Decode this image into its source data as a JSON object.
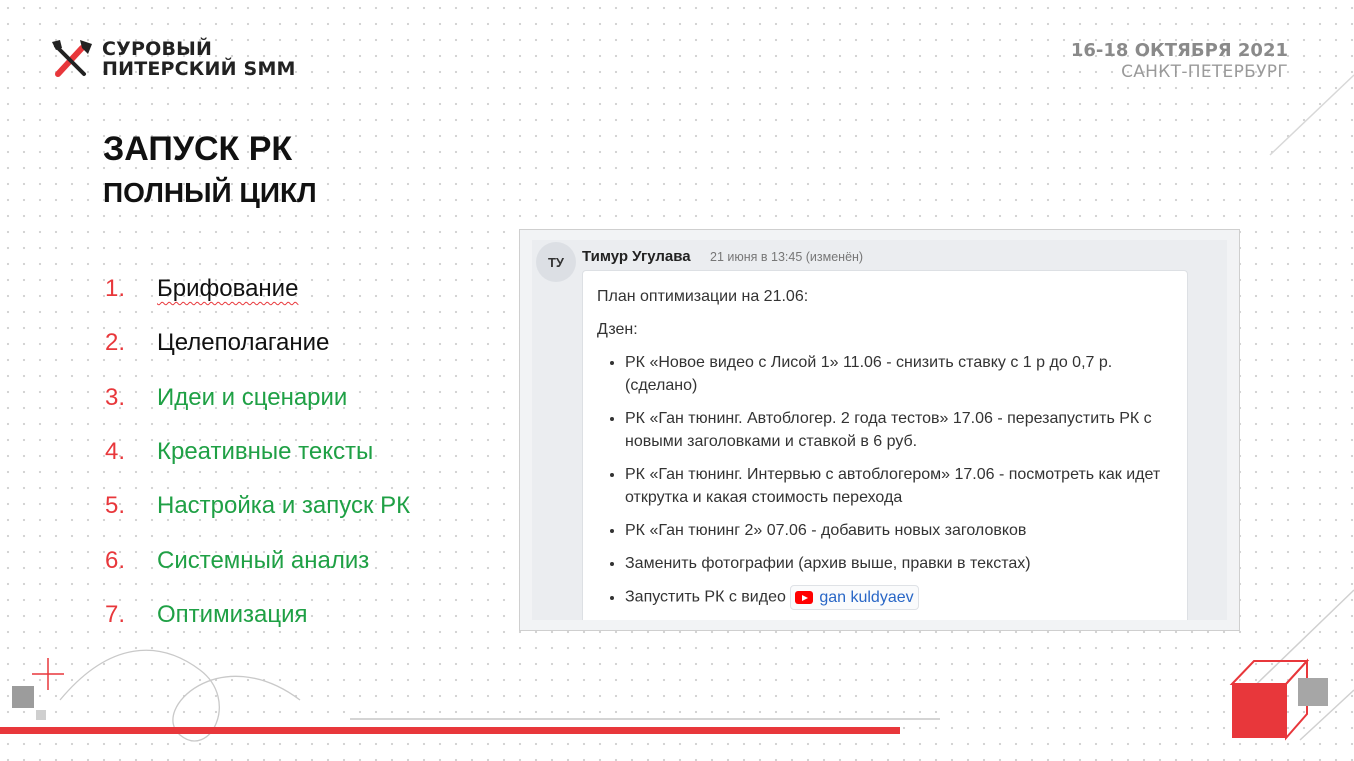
{
  "header": {
    "logo_line1": "СУРОВЫЙ",
    "logo_line2": "ПИТЕРСКИЙ SMM",
    "event_dates": "16-18 ОКТЯБРЯ 2021",
    "event_city": "САНКТ-ПЕТЕРБУРГ"
  },
  "slide": {
    "title": "ЗАПУСК РК",
    "subtitle": "ПОЛНЫЙ ЦИКЛ",
    "steps": [
      {
        "num": "1.",
        "text": "Брифование"
      },
      {
        "num": "2.",
        "text": "Целеполагание"
      },
      {
        "num": "3.",
        "text": "Идеи и сценарии"
      },
      {
        "num": "4.",
        "text": "Креативные тексты"
      },
      {
        "num": "5.",
        "text": "Настройка и запуск РК"
      },
      {
        "num": "6.",
        "text": "Системный анализ"
      },
      {
        "num": "7.",
        "text": "Оптимизация"
      }
    ]
  },
  "message": {
    "avatar": "ТУ",
    "author": "Тимур Угулава",
    "time": "21 июня в 13:45 (изменён)",
    "intro": "План оптимизации на 21.06:",
    "section": "Дзен:",
    "items": [
      "РК «Новое видео с Лисой 1» 11.06 - снизить ставку с 1 р до 0,7 р. (сделано)",
      "РК «Ган тюнинг. Автоблогер. 2 года тестов» 17.06 - перезапустить РК с новыми заголовками и ставкой в 6 руб.",
      "РК «Ган тюнинг. Интервью с автоблогером» 17.06 - посмотреть как идет открутка и какая стоимость перехода",
      "РК «Ган тюнинг 2» 07.06 - добавить новых заголовков",
      "Заменить фотографии (архив выше, правки в текстах)",
      "Запустить РК с видео"
    ],
    "video_link": "gan kuldyaev"
  },
  "colors": {
    "accent_red": "#e8373b",
    "accent_green": "#1fa045",
    "link_blue": "#2866c6"
  },
  "icons": {
    "logo": "crossed-tools-icon",
    "video": "youtube-icon"
  }
}
